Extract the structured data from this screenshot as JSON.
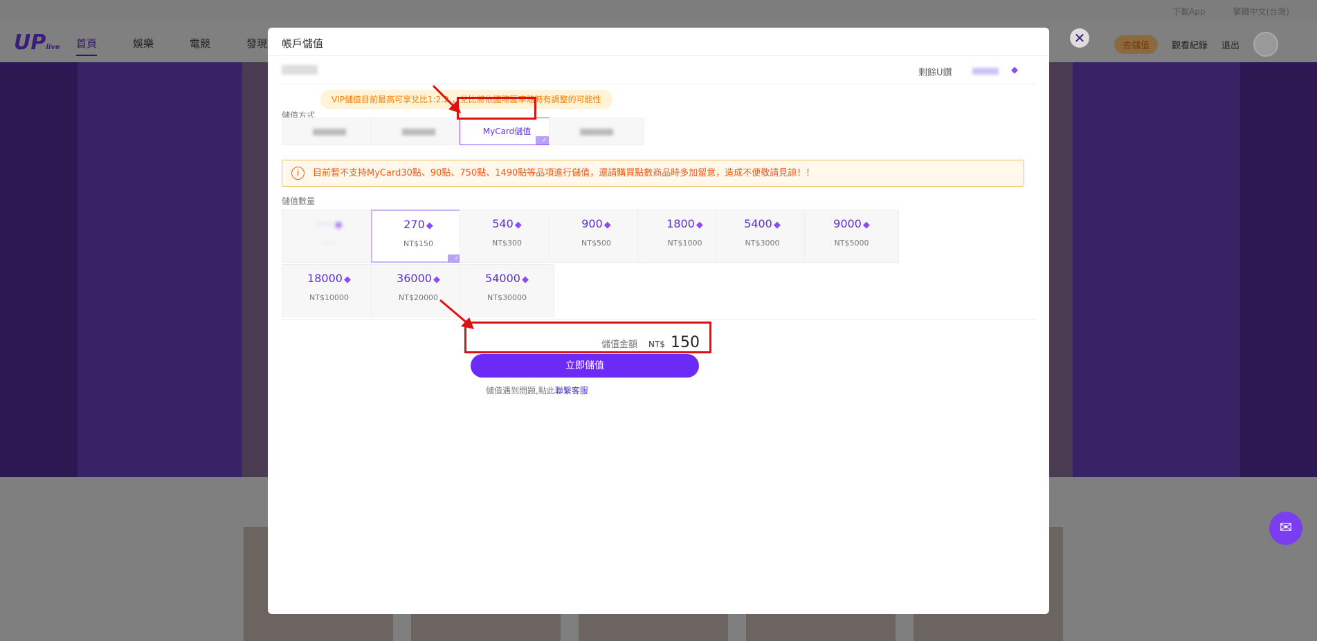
{
  "background": {
    "logo": "UP",
    "logo_sub": "live",
    "nav": [
      "首頁",
      "娛樂",
      "電競",
      "發現"
    ],
    "top_links": [
      "下載App",
      "繁體中文(台灣)"
    ],
    "header_right": {
      "topup": "去儲值",
      "history": "觀看紀錄",
      "logout": "退出"
    }
  },
  "modal": {
    "title": "帳戶儲值",
    "balance_label": "剩餘U鑽",
    "tooltip": "VIP儲值目前最高可享兌比1:2.2 ，兌比將依國際匯率隨時有調整的可能性",
    "method_label": "儲值方式",
    "methods": [
      {
        "label": "",
        "active": false
      },
      {
        "label": "",
        "active": false
      },
      {
        "label": "MyCard儲值",
        "active": true
      },
      {
        "label": "",
        "active": false
      }
    ],
    "notice": "目前暫不支持MyCard30點、90點、750點、1490點等品項進行儲值，還請購買點數商品時多加留意，造成不便敬請見諒！！",
    "amount_label": "儲值數量",
    "packages": [
      {
        "amount": "",
        "price": "",
        "disabled": true,
        "active": false
      },
      {
        "amount": "270",
        "price": "NT$150",
        "disabled": false,
        "active": true
      },
      {
        "amount": "540",
        "price": "NT$300",
        "disabled": false,
        "active": false
      },
      {
        "amount": "900",
        "price": "NT$500",
        "disabled": false,
        "active": false
      },
      {
        "amount": "1800",
        "price": "NT$1000",
        "disabled": false,
        "active": false
      },
      {
        "amount": "5400",
        "price": "NT$3000",
        "disabled": false,
        "active": false
      },
      {
        "amount": "9000",
        "price": "NT$5000",
        "disabled": false,
        "active": false
      },
      {
        "amount": "18000",
        "price": "NT$10000",
        "disabled": false,
        "active": false
      },
      {
        "amount": "36000",
        "price": "NT$20000",
        "disabled": false,
        "active": false
      },
      {
        "amount": "54000",
        "price": "NT$30000",
        "disabled": false,
        "active": false
      }
    ],
    "total_label": "儲值金額",
    "total_currency": "NT$",
    "total_value": "150",
    "pay_button": "立即儲值",
    "help_text": "儲值遇到問題,點此",
    "help_link": "聯繫客服"
  },
  "colors": {
    "accent": "#6b2af5",
    "highlight": "#e01010",
    "warning": "#f05a14"
  }
}
